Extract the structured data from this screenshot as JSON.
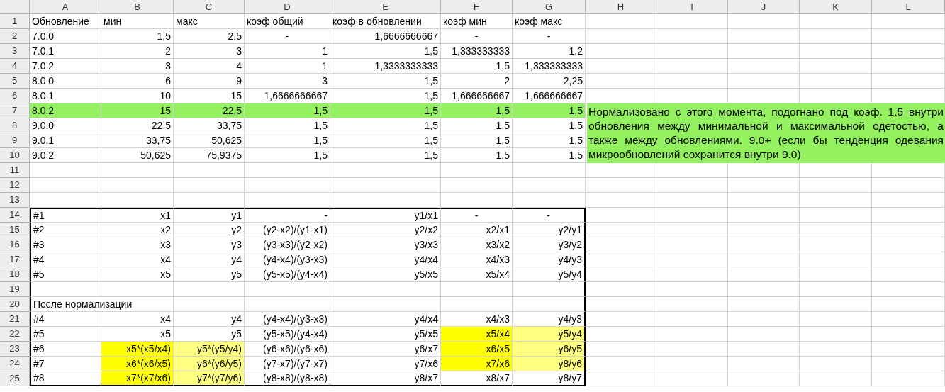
{
  "column_headers": [
    "A",
    "B",
    "C",
    "D",
    "E",
    "F",
    "G",
    "H",
    "I",
    "J",
    "K",
    "L"
  ],
  "rows": [
    {
      "number": "1",
      "cells": [
        {
          "text": "Обновление",
          "kind": "text"
        },
        {
          "text": "мин",
          "kind": "text"
        },
        {
          "text": "макс",
          "kind": "text"
        },
        {
          "text": "коэф общий",
          "kind": "text"
        },
        {
          "text": "коэф в обновлении",
          "kind": "text"
        },
        {
          "text": "коэф мин",
          "kind": "text"
        },
        {
          "text": "коэф макс",
          "kind": "text"
        }
      ]
    },
    {
      "number": "2",
      "cells": [
        {
          "text": "7.0.0",
          "kind": "text"
        },
        {
          "text": "1,5",
          "kind": "number"
        },
        {
          "text": "2,5",
          "kind": "number"
        },
        {
          "text": "-",
          "kind": "dash"
        },
        {
          "text": "1,6666666667",
          "kind": "number"
        },
        {
          "text": "-",
          "kind": "dash"
        },
        {
          "text": "-",
          "kind": "dash"
        }
      ]
    },
    {
      "number": "3",
      "cells": [
        {
          "text": "7.0.1",
          "kind": "text"
        },
        {
          "text": "2",
          "kind": "number"
        },
        {
          "text": "3",
          "kind": "number"
        },
        {
          "text": "1",
          "kind": "number"
        },
        {
          "text": "1,5",
          "kind": "number"
        },
        {
          "text": "1,333333333",
          "kind": "number"
        },
        {
          "text": "1,2",
          "kind": "number"
        }
      ]
    },
    {
      "number": "4",
      "cells": [
        {
          "text": "7.0.2",
          "kind": "text"
        },
        {
          "text": "3",
          "kind": "number"
        },
        {
          "text": "4",
          "kind": "number"
        },
        {
          "text": "1",
          "kind": "number"
        },
        {
          "text": "1,3333333333",
          "kind": "number"
        },
        {
          "text": "1,5",
          "kind": "number"
        },
        {
          "text": "1,333333333",
          "kind": "number"
        }
      ]
    },
    {
      "number": "5",
      "cells": [
        {
          "text": "8.0.0",
          "kind": "text"
        },
        {
          "text": "6",
          "kind": "number"
        },
        {
          "text": "9",
          "kind": "number"
        },
        {
          "text": "3",
          "kind": "number"
        },
        {
          "text": "1,5",
          "kind": "number"
        },
        {
          "text": "2",
          "kind": "number"
        },
        {
          "text": "2,25",
          "kind": "number"
        }
      ]
    },
    {
      "number": "6",
      "cells": [
        {
          "text": "8.0.1",
          "kind": "text"
        },
        {
          "text": "10",
          "kind": "number"
        },
        {
          "text": "15",
          "kind": "number"
        },
        {
          "text": "1,6666666667",
          "kind": "number"
        },
        {
          "text": "1,5",
          "kind": "number"
        },
        {
          "text": "1,666666667",
          "kind": "number"
        },
        {
          "text": "1,666666667",
          "kind": "number"
        }
      ]
    },
    {
      "number": "7",
      "cells": [
        {
          "text": "8.0.2",
          "kind": "text",
          "color": "#93f15f"
        },
        {
          "text": "15",
          "kind": "number",
          "color": "#93f15f"
        },
        {
          "text": "22,5",
          "kind": "number",
          "color": "#93f15f"
        },
        {
          "text": "1,5",
          "kind": "number",
          "color": "#93f15f"
        },
        {
          "text": "1,5",
          "kind": "number",
          "color": "#93f15f"
        },
        {
          "text": "1,5",
          "kind": "number",
          "color": "#93f15f"
        },
        {
          "text": "1,5",
          "kind": "number",
          "color": "#93f15f"
        }
      ]
    },
    {
      "number": "8",
      "cells": [
        {
          "text": "9.0.0",
          "kind": "text"
        },
        {
          "text": "22,5",
          "kind": "number"
        },
        {
          "text": "33,75",
          "kind": "number"
        },
        {
          "text": "1,5",
          "kind": "number"
        },
        {
          "text": "1,5",
          "kind": "number"
        },
        {
          "text": "1,5",
          "kind": "number"
        },
        {
          "text": "1,5",
          "kind": "number"
        }
      ]
    },
    {
      "number": "9",
      "cells": [
        {
          "text": "9.0.1",
          "kind": "text"
        },
        {
          "text": "33,75",
          "kind": "number"
        },
        {
          "text": "50,625",
          "kind": "number"
        },
        {
          "text": "1,5",
          "kind": "number"
        },
        {
          "text": "1,5",
          "kind": "number"
        },
        {
          "text": "1,5",
          "kind": "number"
        },
        {
          "text": "1,5",
          "kind": "number"
        }
      ]
    },
    {
      "number": "10",
      "cells": [
        {
          "text": "9.0.2",
          "kind": "text"
        },
        {
          "text": "50,625",
          "kind": "number"
        },
        {
          "text": "75,9375",
          "kind": "number"
        },
        {
          "text": "1,5",
          "kind": "number"
        },
        {
          "text": "1,5",
          "kind": "number"
        },
        {
          "text": "1,5",
          "kind": "number"
        },
        {
          "text": "1,5",
          "kind": "number"
        }
      ]
    },
    {
      "number": "11",
      "cells": []
    },
    {
      "number": "12",
      "cells": []
    },
    {
      "number": "13",
      "cells": []
    },
    {
      "number": "14",
      "cells": [
        {
          "text": "#1",
          "kind": "text"
        },
        {
          "text": "x1",
          "kind": "number"
        },
        {
          "text": "y1",
          "kind": "number"
        },
        {
          "text": "-",
          "kind": "number"
        },
        {
          "text": "y1/x1",
          "kind": "number"
        },
        {
          "text": "-",
          "kind": "dash"
        },
        {
          "text": "-",
          "kind": "dash"
        }
      ]
    },
    {
      "number": "15",
      "cells": [
        {
          "text": "#2",
          "kind": "text"
        },
        {
          "text": "x2",
          "kind": "number"
        },
        {
          "text": "y2",
          "kind": "number"
        },
        {
          "text": "(y2-x2)/(y1-x1)",
          "kind": "number"
        },
        {
          "text": "y2/x2",
          "kind": "number"
        },
        {
          "text": "x2/x1",
          "kind": "number"
        },
        {
          "text": "y2/y1",
          "kind": "number"
        }
      ]
    },
    {
      "number": "16",
      "cells": [
        {
          "text": "#3",
          "kind": "text"
        },
        {
          "text": "x3",
          "kind": "number"
        },
        {
          "text": "y3",
          "kind": "number"
        },
        {
          "text": "(y3-x3)/(y2-x2)",
          "kind": "number"
        },
        {
          "text": "y3/x3",
          "kind": "number"
        },
        {
          "text": "x3/x2",
          "kind": "number"
        },
        {
          "text": "y3/y2",
          "kind": "number"
        }
      ]
    },
    {
      "number": "17",
      "cells": [
        {
          "text": "#4",
          "kind": "text"
        },
        {
          "text": "x4",
          "kind": "number"
        },
        {
          "text": "y4",
          "kind": "number"
        },
        {
          "text": "(y4-x4)/(y3-x3)",
          "kind": "number"
        },
        {
          "text": "y4/x4",
          "kind": "number"
        },
        {
          "text": "x4/x3",
          "kind": "number"
        },
        {
          "text": "y4/y3",
          "kind": "number"
        }
      ]
    },
    {
      "number": "18",
      "cells": [
        {
          "text": "#5",
          "kind": "text"
        },
        {
          "text": "x5",
          "kind": "number"
        },
        {
          "text": "y5",
          "kind": "number"
        },
        {
          "text": "(y5-x5)/(y4-x4)",
          "kind": "number"
        },
        {
          "text": "y5/x5",
          "kind": "number"
        },
        {
          "text": "x5/x4",
          "kind": "number"
        },
        {
          "text": "y5/y4",
          "kind": "number"
        }
      ]
    },
    {
      "number": "19",
      "cells": []
    },
    {
      "number": "20",
      "cells": [
        {
          "text": "После нормализации",
          "kind": "text"
        }
      ]
    },
    {
      "number": "21",
      "cells": [
        {
          "text": "#4",
          "kind": "text"
        },
        {
          "text": "x4",
          "kind": "number"
        },
        {
          "text": "y4",
          "kind": "number"
        },
        {
          "text": "(y4-x4)/(y3-x3)",
          "kind": "number"
        },
        {
          "text": "y4/x4",
          "kind": "number"
        },
        {
          "text": "x4/x3",
          "kind": "number"
        },
        {
          "text": "y4/y3",
          "kind": "number"
        }
      ]
    },
    {
      "number": "22",
      "cells": [
        {
          "text": "#5",
          "kind": "text"
        },
        {
          "text": "x5",
          "kind": "number"
        },
        {
          "text": "y5",
          "kind": "number"
        },
        {
          "text": "(y5-x5)/(y4-x4)",
          "kind": "number"
        },
        {
          "text": "y5/x5",
          "kind": "number"
        },
        {
          "text": "x5/x4",
          "kind": "number",
          "color": "#ffff00"
        },
        {
          "text": "y5/y4",
          "kind": "number",
          "color": "#ffff80"
        }
      ]
    },
    {
      "number": "23",
      "cells": [
        {
          "text": "#6",
          "kind": "text"
        },
        {
          "text": "x5*(x5/x4)",
          "kind": "number",
          "color": "#ffff00"
        },
        {
          "text": "y5*(y5/y4)",
          "kind": "number",
          "color": "#ffff80"
        },
        {
          "text": "(y6-x6)/(y6-x6)",
          "kind": "number"
        },
        {
          "text": "y6/x7",
          "kind": "number"
        },
        {
          "text": "x6/x5",
          "kind": "number",
          "color": "#ffff00"
        },
        {
          "text": "y6/y5",
          "kind": "number",
          "color": "#ffff80"
        }
      ]
    },
    {
      "number": "24",
      "cells": [
        {
          "text": "#7",
          "kind": "text"
        },
        {
          "text": "x6*(x6/x5)",
          "kind": "number",
          "color": "#ffff00"
        },
        {
          "text": "y6*(y6/y5)",
          "kind": "number",
          "color": "#ffff80"
        },
        {
          "text": "(y7-x7)/(y7-x7)",
          "kind": "number"
        },
        {
          "text": "y7/x6",
          "kind": "number"
        },
        {
          "text": "x7/x6",
          "kind": "number",
          "color": "#ffff00"
        },
        {
          "text": "y8/y6",
          "kind": "number",
          "color": "#ffff80"
        }
      ]
    },
    {
      "number": "25",
      "cells": [
        {
          "text": "#8",
          "kind": "text"
        },
        {
          "text": "x7*(x7/x6)",
          "kind": "number",
          "color": "#ffff00"
        },
        {
          "text": "y7*(y7/y6)",
          "kind": "number",
          "color": "#ffff80"
        },
        {
          "text": "(y8-x8)/(y8-x8)",
          "kind": "number"
        },
        {
          "text": "y8/x7",
          "kind": "number"
        },
        {
          "text": "x8/x7",
          "kind": "number"
        },
        {
          "text": "y8/y7",
          "kind": "number"
        }
      ]
    }
  ],
  "note": {
    "text": "Нормализовано с этого момента, подогнано под коэф. 1.5 внутри обновления между минимальной и максимальной одетостью, а также между обновлениями. 9.0+ (если бы тенденция одевания микрообновлений сохранится внутри 9.0)",
    "color": "#93f15f"
  }
}
